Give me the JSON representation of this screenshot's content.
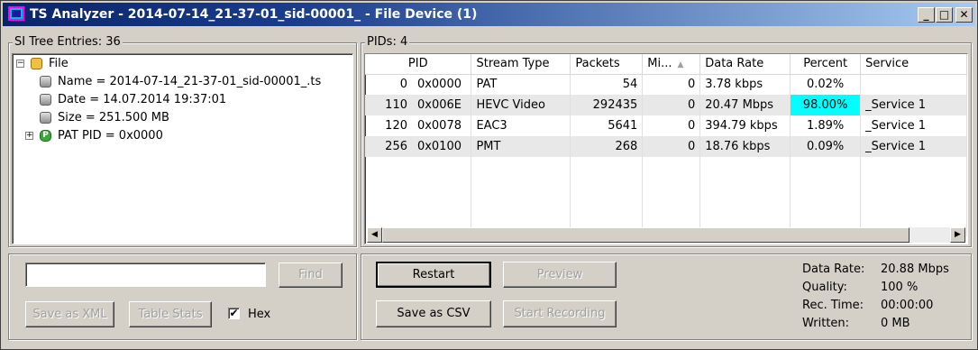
{
  "window": {
    "title": "TS Analyzer - 2014-07-14_21-37-01_sid-00001_ - File Device (1)",
    "minimize": "_",
    "maximize": "□",
    "close": "✕"
  },
  "si_tree": {
    "label": "SI Tree Entries: 36",
    "root": "File",
    "items": [
      "Name = 2014-07-14_21-37-01_sid-00001_.ts",
      "Date = 14.07.2014 19:37:01",
      "Size = 251.500 MB"
    ],
    "pat": "PAT PID = 0x0000",
    "pat_icon_letter": "P",
    "find_input_value": "",
    "find_label": "Find",
    "save_xml_label": "Save as XML",
    "table_stats_label": "Table Stats",
    "hex_label": "Hex",
    "hex_checked": "✔"
  },
  "pids": {
    "label": "PIDs: 4",
    "columns": [
      "PID",
      "Stream Type",
      "Packets",
      "Mi...",
      "Data Rate",
      "Percent",
      "Service"
    ],
    "rows": [
      {
        "pid_dec": "0",
        "pid_hex": "0x0000",
        "stream_type": "PAT",
        "packets": "54",
        "mi": "0",
        "data_rate": "3.78 kbps",
        "percent": "0.02%",
        "service": ""
      },
      {
        "pid_dec": "110",
        "pid_hex": "0x006E",
        "stream_type": "HEVC Video",
        "packets": "292435",
        "mi": "0",
        "data_rate": "20.47 Mbps",
        "percent": "98.00%",
        "service": "_Service 1"
      },
      {
        "pid_dec": "120",
        "pid_hex": "0x0078",
        "stream_type": "EAC3",
        "packets": "5641",
        "mi": "0",
        "data_rate": "394.79 kbps",
        "percent": "1.89%",
        "service": "_Service 1"
      },
      {
        "pid_dec": "256",
        "pid_hex": "0x0100",
        "stream_type": "PMT",
        "packets": "268",
        "mi": "0",
        "data_rate": "18.76 kbps",
        "percent": "0.09%",
        "service": "_Service 1"
      }
    ],
    "highlight_color": "#00ffff",
    "restart_label": "Restart",
    "preview_label": "Preview",
    "save_csv_label": "Save as CSV",
    "start_recording_label": "Start Recording"
  },
  "stats": {
    "data_rate_label": "Data Rate:",
    "data_rate_value": "20.88 Mbps",
    "quality_label": "Quality:",
    "quality_value": "100 %",
    "rec_time_label": "Rec. Time:",
    "rec_time_value": "00:00:00",
    "written_label": "Written:",
    "written_value": "0 MB"
  }
}
